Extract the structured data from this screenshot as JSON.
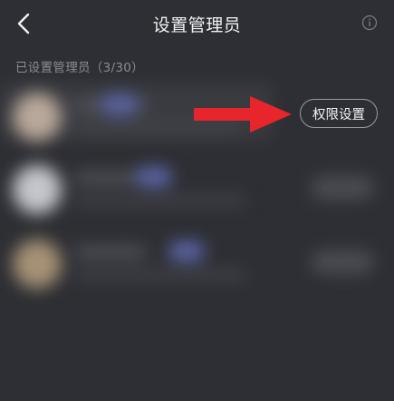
{
  "header": {
    "title": "设置管理员",
    "back_icon": "chevron-left-icon",
    "info_icon": "info-circle-icon"
  },
  "admins_section": {
    "label": "已设置管理员（3/30）"
  },
  "admin_rows": [
    {
      "action_label": "权限设置"
    }
  ],
  "colors": {
    "background": "#2e2f34",
    "title": "#f2f2f4",
    "section_label": "#8e8f96",
    "arrow": "#e8252b"
  }
}
